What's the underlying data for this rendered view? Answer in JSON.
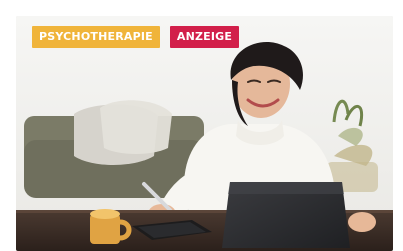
{
  "article": {
    "category_badge": "PSYCHOTHERAPIE",
    "ad_badge": "ANZEIGE",
    "image_subject": "woman-smiling-with-laptop-and-tablet"
  },
  "colors": {
    "category_badge_bg": "#f0b43a",
    "ad_badge_bg": "#d21f4a",
    "badge_text": "#ffffff"
  }
}
